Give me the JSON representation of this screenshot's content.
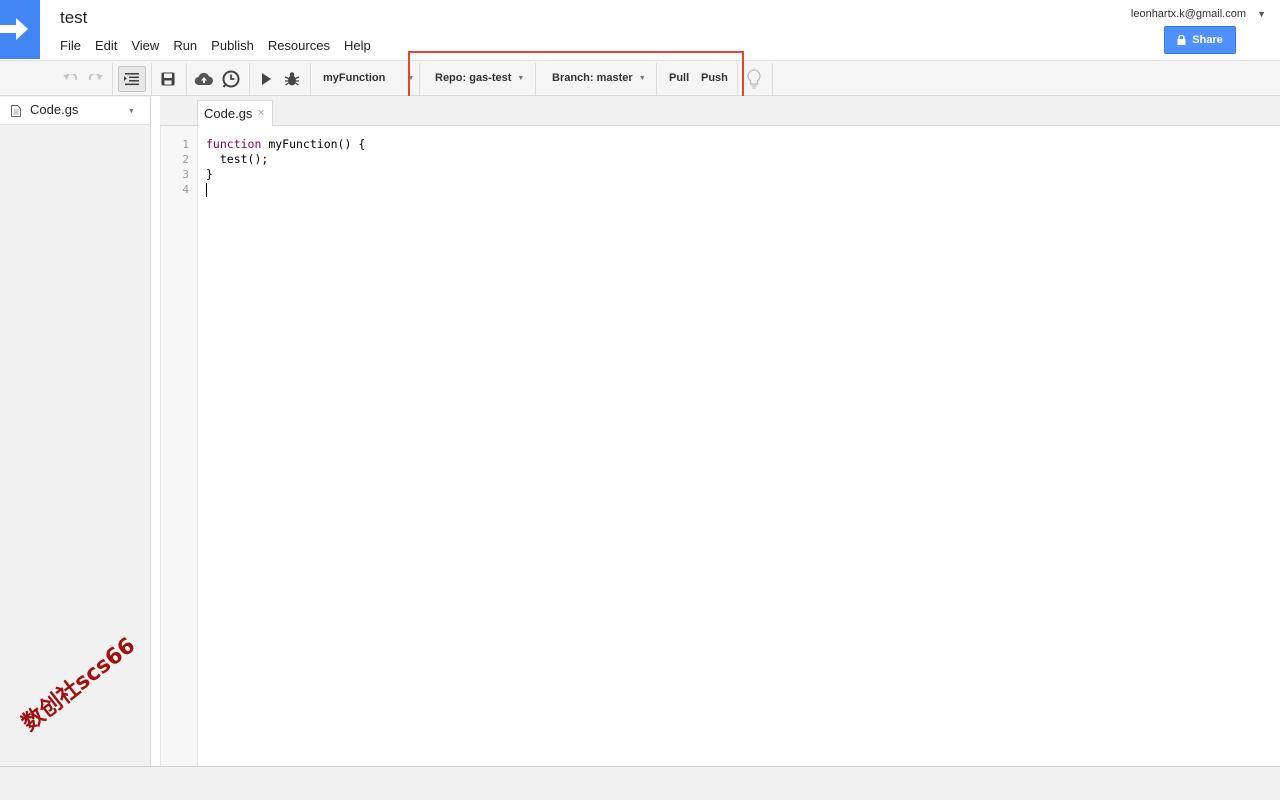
{
  "app": {
    "title": "test",
    "menu": [
      "File",
      "Edit",
      "View",
      "Run",
      "Publish",
      "Resources",
      "Help"
    ],
    "account_email": "leonhartx.k@gmail.com",
    "share_label": "Share"
  },
  "toolbar": {
    "function_select": "myFunction",
    "repo_label": "Repo: gas-test",
    "branch_label": "Branch: master",
    "pull_label": "Pull",
    "push_label": "Push"
  },
  "sidebar": {
    "files": [
      {
        "name": "Code.gs"
      }
    ]
  },
  "editor": {
    "tabs": [
      {
        "label": "Code.gs",
        "close": "×"
      }
    ],
    "line_numbers": [
      "1",
      "2",
      "3",
      "4"
    ],
    "lines": [
      "function myFunction() {",
      "  test();",
      "}",
      ""
    ]
  },
  "watermark": "数创社scs66",
  "colors": {
    "brand": "#4285f4",
    "share_button": "#4d90fe",
    "highlight_box": "#e8432a",
    "keyword": "#7f0055"
  }
}
